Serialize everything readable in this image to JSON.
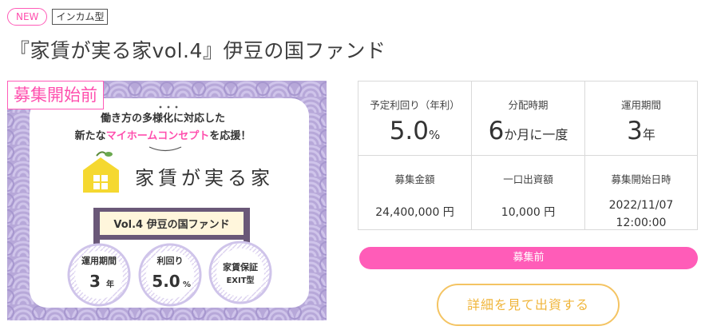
{
  "tags": {
    "new": "NEW",
    "type": "インカム型"
  },
  "title": "『家賃が実る家vol.4』伊豆の国ファンド",
  "hero": {
    "status_label": "募集開始前",
    "catch_line1": "働き方の多様化に対応した",
    "catch_line2_a": "新たな",
    "catch_line2_b": "マイホームコンセプト",
    "catch_line2_c": "を応援！",
    "brand": "家賃が実る家",
    "fund_name": "Vol.4 伊豆の国ファンド",
    "badge1_title": "運用期間",
    "badge1_value": "3",
    "badge1_unit": "年",
    "badge2_title": "利回り",
    "badge2_value": "5.0",
    "badge2_unit": "%",
    "badge3_title": "家賃保証",
    "badge3_sub": "EXIT型",
    "colors": {
      "purple": "#b5a6d8",
      "purple_dark": "#6a5878",
      "pink": "#ff4fae",
      "yellow": "#f5d830"
    }
  },
  "stats": {
    "yield_label": "予定利回り（年利）",
    "yield_value": "5.0",
    "yield_unit": "%",
    "dist_label": "分配時期",
    "dist_value": "6",
    "dist_unit": "か月に一度",
    "period_label": "運用期間",
    "period_value": "3",
    "period_unit": "年",
    "amount_label": "募集金額",
    "amount_value": "24,400,000 円",
    "unit_label": "一口出資額",
    "unit_value": "10,000 円",
    "start_label": "募集開始日時",
    "start_date": "2022/11/07",
    "start_time": "12:00:00"
  },
  "status_bar": "募集前",
  "detail_button": "詳細を見て出資する"
}
